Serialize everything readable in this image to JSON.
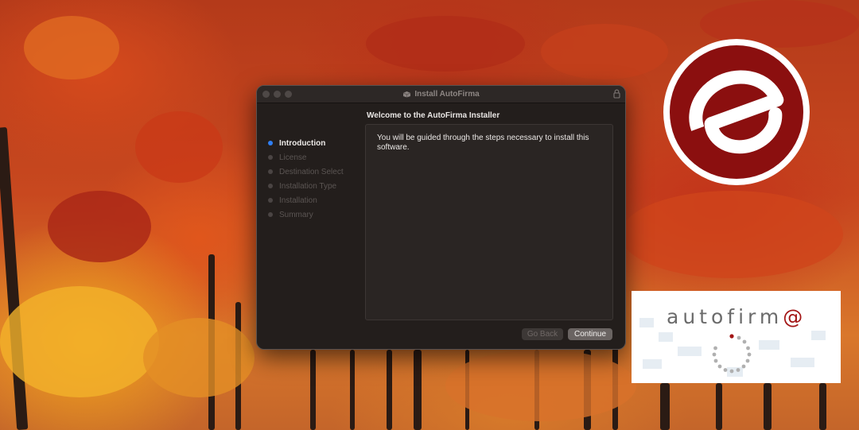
{
  "window": {
    "title": "Install AutoFirma",
    "heading": "Welcome to the AutoFirma Installer",
    "body_text": "You will be guided through the steps necessary to install this software.",
    "steps": [
      {
        "label": "Introduction",
        "active": true
      },
      {
        "label": "License",
        "active": false
      },
      {
        "label": "Destination Select",
        "active": false
      },
      {
        "label": "Installation Type",
        "active": false
      },
      {
        "label": "Installation",
        "active": false
      },
      {
        "label": "Summary",
        "active": false
      }
    ],
    "buttons": {
      "back_label": "Go Back",
      "continue_label": "Continue"
    }
  },
  "logos": {
    "e_logo_color": "#8b0f0f",
    "autofirma_wordmark": "autofirm@",
    "autofirma_accent": "#a31515"
  },
  "colors": {
    "active_step": "#2f7ff4",
    "window_bg": "#231e1c"
  }
}
